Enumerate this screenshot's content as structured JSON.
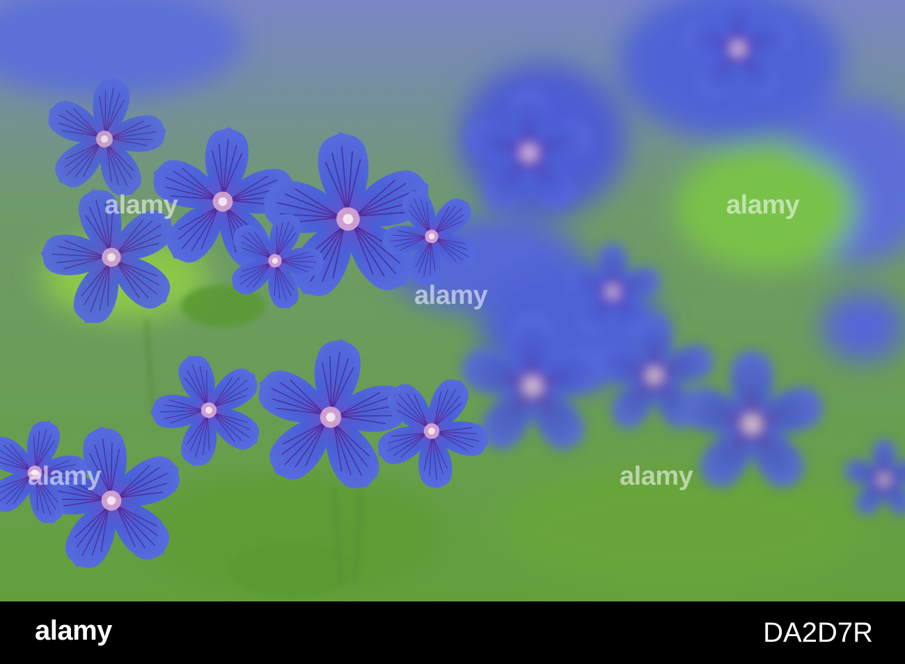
{
  "photo": {
    "subject": "blue geranium flowers",
    "colors": {
      "background_green": "#6fa24a",
      "petal_blue": "#4a5fd6",
      "petal_dark": "#2c2fa0",
      "vein_purple": "#5a2a8a",
      "center_pink": "#e8b8d0"
    }
  },
  "watermark": {
    "text": "alamy"
  },
  "footer": {
    "logo": "alamy",
    "image_id": "DA2D7R",
    "background": "#000000"
  }
}
